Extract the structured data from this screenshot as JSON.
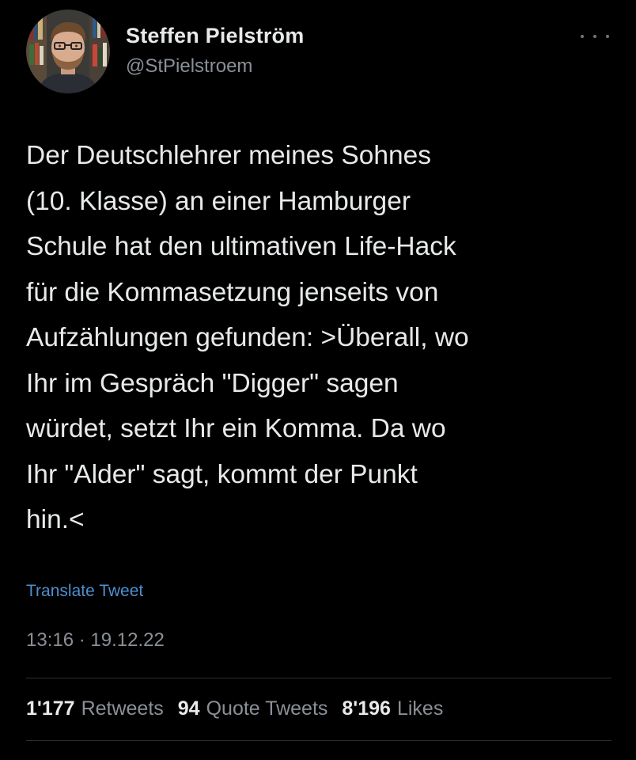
{
  "author": {
    "display_name": "Steffen Pielström",
    "handle": "@StPielstroem",
    "avatar_icon": "profile-photo"
  },
  "more_icon": "more-horizontal-icon",
  "tweet": {
    "lines": [
      "Der Deutschlehrer meines Sohnes",
      "(10. Klasse) an einer Hamburger",
      "Schule hat den ultimativen Life-Hack",
      "für die Kommasetzung jenseits von",
      "Aufzählungen gefunden: >Überall, wo",
      "Ihr im Gespräch \"Digger\" sagen",
      "würdet, setzt Ihr ein Komma. Da wo",
      "Ihr \"Alder\" sagt, kommt der Punkt",
      "hin.<"
    ],
    "translate_label": "Translate Tweet",
    "timestamp": "13:16 · 19.12.22"
  },
  "stats": {
    "retweets": {
      "count": "1'177",
      "label": "Retweets"
    },
    "quote_tweets": {
      "count": "94",
      "label": "Quote Tweets"
    },
    "likes": {
      "count": "8'196",
      "label": "Likes"
    }
  },
  "colors": {
    "background": "#000000",
    "text_primary": "#e7e9ea",
    "text_secondary": "#8b9097",
    "link": "#4e8fcf",
    "divider": "#2a2e33"
  }
}
